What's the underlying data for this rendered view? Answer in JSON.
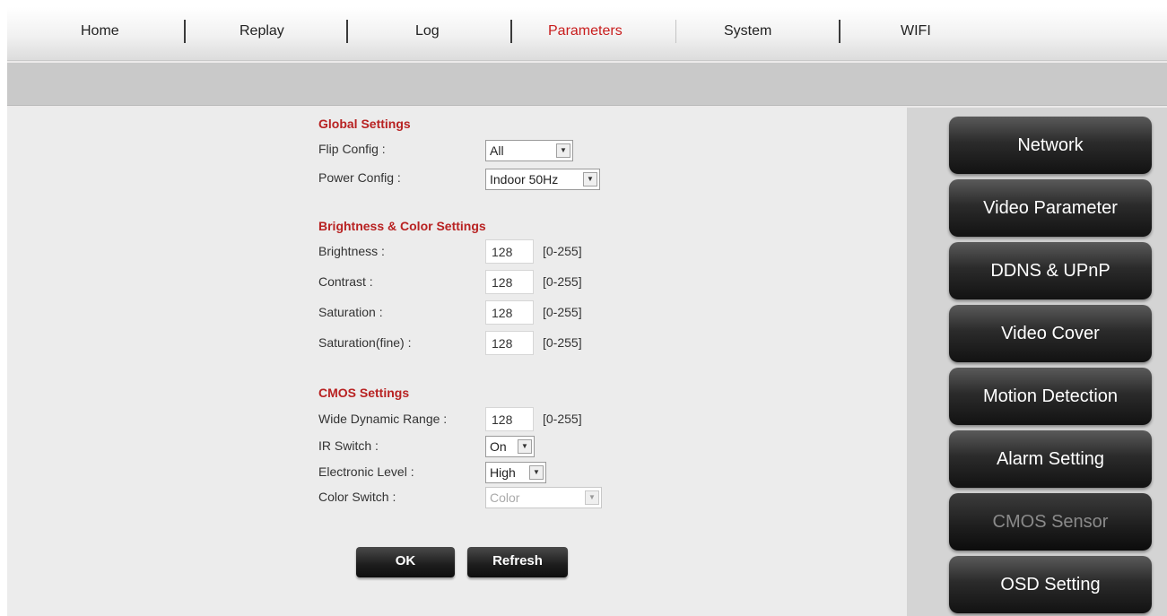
{
  "nav": {
    "items": [
      {
        "label": "Home"
      },
      {
        "label": "Replay"
      },
      {
        "label": "Log"
      },
      {
        "label": "Parameters",
        "active": true
      },
      {
        "label": "System"
      },
      {
        "label": "WIFI"
      }
    ],
    "active_color": "#c81c1c"
  },
  "global_settings": {
    "title": "Global Settings",
    "flip_label": "Flip Config :",
    "flip_value": "All",
    "power_label": "Power Config :",
    "power_value": "Indoor 50Hz"
  },
  "brightness_settings": {
    "title": "Brightness & Color Settings",
    "fields": [
      {
        "label": "Brightness :",
        "value": "128",
        "range": "[0-255]"
      },
      {
        "label": "Contrast :",
        "value": "128",
        "range": "[0-255]"
      },
      {
        "label": "Saturation :",
        "value": "128",
        "range": "[0-255]"
      },
      {
        "label": "Saturation(fine) :",
        "value": "128",
        "range": "[0-255]"
      }
    ]
  },
  "cmos_settings": {
    "title": "CMOS Settings",
    "wdr_label": "Wide Dynamic Range :",
    "wdr_value": "128",
    "wdr_range": "[0-255]",
    "ir_label": "IR Switch :",
    "ir_value": "On",
    "level_label": "Electronic Level :",
    "level_value": "High",
    "color_label": "Color Switch :",
    "color_value": "Color"
  },
  "actions": {
    "ok_label": "OK",
    "refresh_label": "Refresh"
  },
  "sidebar": {
    "items": [
      {
        "label": "Network"
      },
      {
        "label": "Video Parameter"
      },
      {
        "label": "DDNS & UPnP"
      },
      {
        "label": "Video Cover"
      },
      {
        "label": "Motion Detection"
      },
      {
        "label": "Alarm Setting"
      },
      {
        "label": "CMOS Sensor",
        "active": true
      },
      {
        "label": "OSD Setting"
      }
    ]
  },
  "colors": {
    "section_title": "#b82222",
    "sidebar_bg": "#d4d4d4"
  }
}
